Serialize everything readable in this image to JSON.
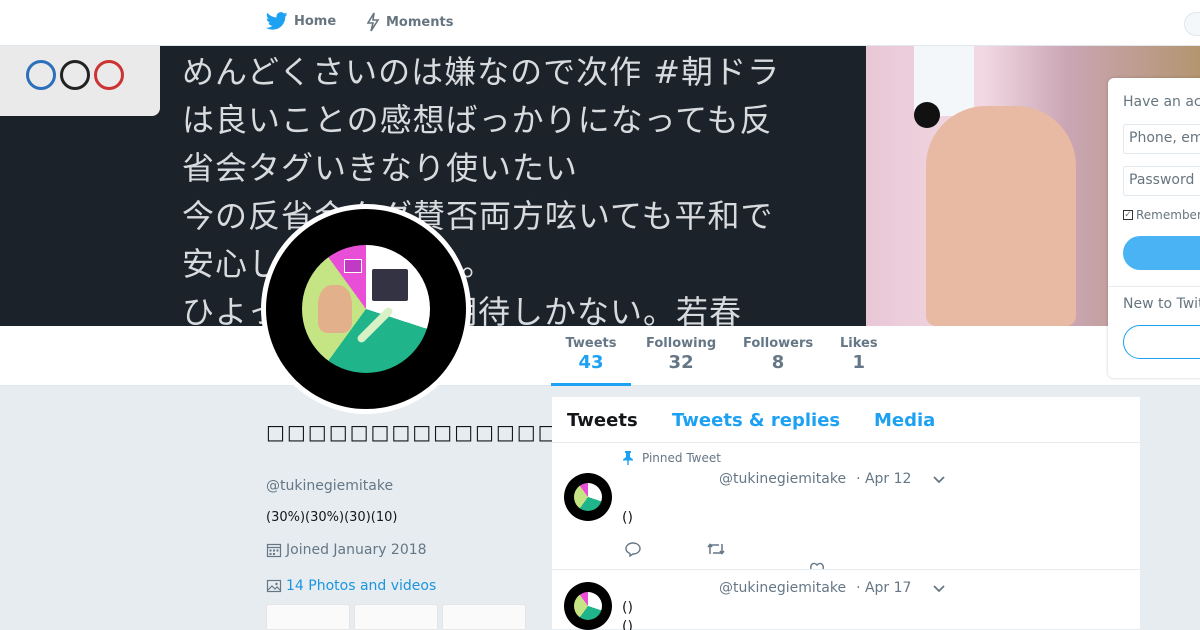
{
  "nav": {
    "home_label": "Home",
    "moments_label": "Moments"
  },
  "banner": {
    "text": "めんどくさいのは嫌なので次作 #朝ドラ\nは良いことの感想ばっかりになっても反\n省会タグいきなり使いたい\n今の反省会タグ賛否両方呟いても平和で\n安心しててよいよ。。\nひよっこは褒めて期待しかない。若春"
  },
  "stats": {
    "tweets": {
      "label": "Tweets",
      "value": "43"
    },
    "following": {
      "label": "Following",
      "value": "32"
    },
    "followers": {
      "label": "Followers",
      "value": "8"
    },
    "likes": {
      "label": "Likes",
      "value": "1"
    }
  },
  "login": {
    "title": "Have an account?",
    "phone_placeholder": "Phone, email or username",
    "password_placeholder": "Password",
    "remember": "Remember me",
    "new_to": "New to Twitter?"
  },
  "profile": {
    "name": "□□□□□□□□□□□□□□□□□□□□□□□□",
    "handle": "@tukinegiemitake",
    "bio": "(30%)(30%)(30)(10)",
    "joined": "Joined January 2018",
    "photos": "14 Photos and videos"
  },
  "timeline": {
    "tabs": [
      "Tweets",
      "Tweets & replies",
      "Media"
    ],
    "pinned_label": "Pinned Tweet",
    "tweets": [
      {
        "handle": "@tukinegiemitake",
        "date": "· Apr 12",
        "text": "()"
      },
      {
        "handle": "@tukinegiemitake",
        "date": "· Apr 17",
        "text": "()\n()"
      }
    ]
  },
  "colors": {
    "accent": "#1da1f2",
    "background": "#e6ecf0",
    "pie": [
      "#e94fd6",
      "#ffffff",
      "#1fb48a",
      "#c5e484"
    ]
  }
}
